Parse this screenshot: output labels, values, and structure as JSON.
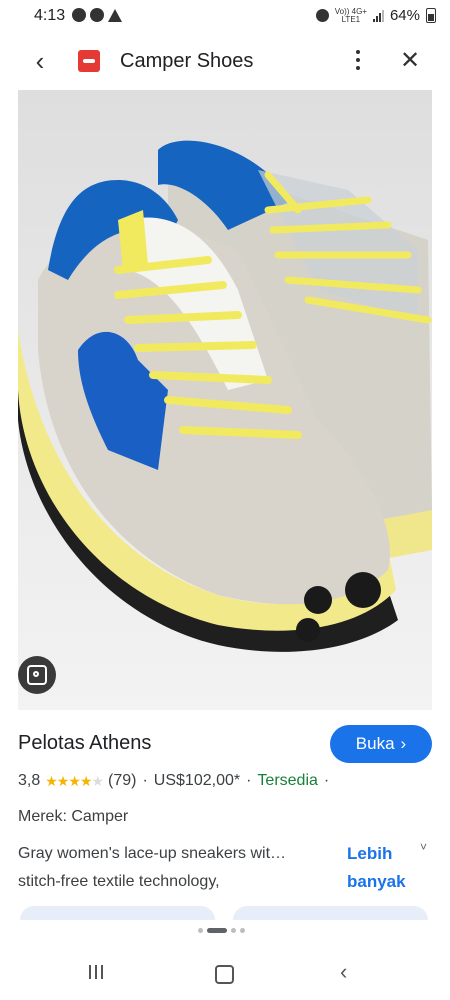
{
  "status_bar": {
    "time": "4:13",
    "network_label_top": "Vo)) 4G+",
    "network_label_bottom": "LTE1",
    "battery": "64%"
  },
  "header": {
    "title": "Camper Shoes",
    "back_icon": "arrow-left-icon",
    "menu_icon": "more-vert-icon",
    "close_icon": "close-icon",
    "brand_color": "#e53935"
  },
  "image": {
    "subject": "yellow and blue sneakers",
    "lens_icon": "google-lens-icon"
  },
  "product": {
    "name": "Pelotas Athens",
    "buy_label": "Buka",
    "buy_chevron": "›",
    "rating": "3,8",
    "rating_value": 3.8,
    "reviews": "(79)",
    "separator": "·",
    "price": "US$102,00*",
    "availability": "Tersedia",
    "brand_line": "Merek: Camper",
    "description_line1": "Gray women's lace-up sneakers wit…",
    "description_line2": "stitch-free textile technology,",
    "more_line1": "Lebih",
    "more_line2": "banyak",
    "more_chevron": "˅"
  },
  "colors": {
    "accent": "#1a73e8",
    "availability": "#188038",
    "stars": "#f4b400"
  },
  "navbar": {
    "recent_icon": "recent-apps-icon",
    "home_icon": "home-icon",
    "back_icon": "nav-back-icon"
  }
}
